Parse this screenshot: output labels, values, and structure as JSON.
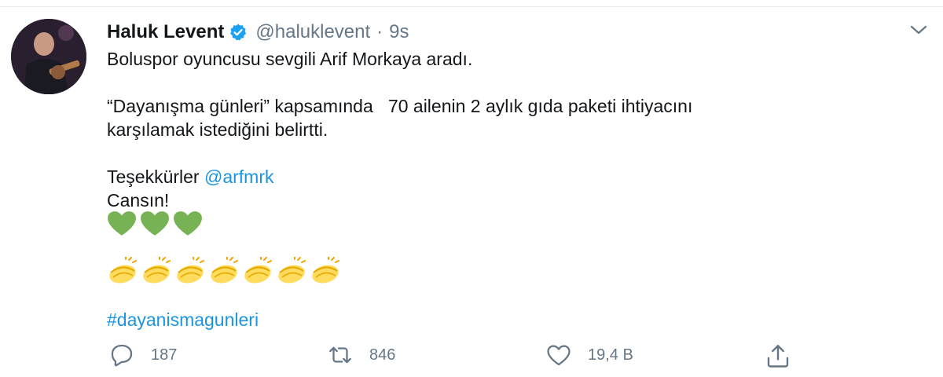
{
  "tweet": {
    "author_name": "Haluk Levent",
    "handle": "@haluklevent",
    "separator": "·",
    "time": "9s",
    "line1": "Boluspor oyuncusu sevgili Arif Morkaya aradı.",
    "line2": "“Dayanışma günleri” kapsamında   70 ailenin 2 aylık gıda paketi ihtiyacını",
    "line3": "karşılamak istediğini belirtti.",
    "thanks_text": "Teşekkürler ",
    "mention": "@arfmrk",
    "line5": "Cansın!",
    "hashtag": "#dayanismagunleri",
    "hearts_count": 3,
    "claps_count": 7
  },
  "actions": {
    "replies": "187",
    "retweets": "846",
    "likes": "19,4 B"
  },
  "colors": {
    "accent": "#1b95e0",
    "secondary_text": "#657786",
    "heart_green": "#77b255",
    "clap_yellow": "#ffdc5d"
  },
  "icons": [
    "verified-badge-icon",
    "chevron-down-icon",
    "reply-icon",
    "retweet-icon",
    "like-icon",
    "share-icon",
    "green-heart-emoji",
    "clapping-hands-emoji"
  ]
}
